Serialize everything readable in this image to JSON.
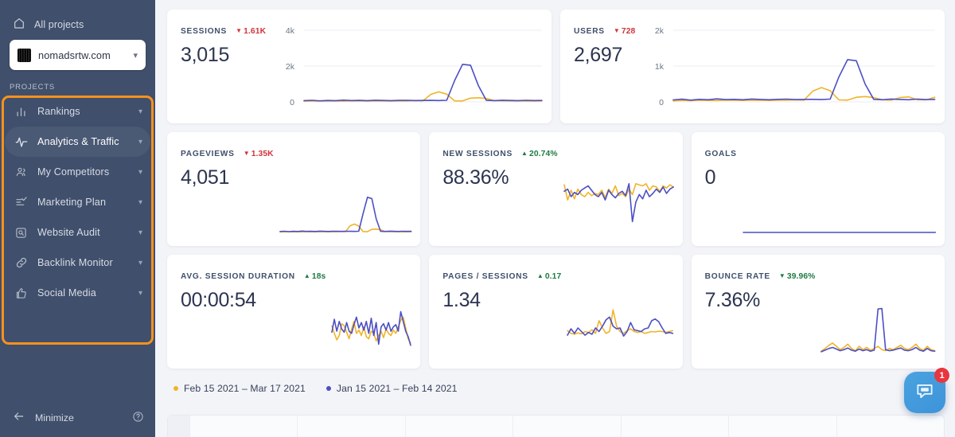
{
  "sidebar": {
    "all_projects_label": "All projects",
    "project_selector": {
      "name": "nomadsrtw.com",
      "chevron": "chevron-down-icon"
    },
    "section_label": "PROJECTS",
    "items": [
      {
        "label": "Rankings",
        "icon": "bar-chart-icon",
        "active": false
      },
      {
        "label": "Analytics & Traffic",
        "icon": "pulse-icon",
        "active": true
      },
      {
        "label": "My Competitors",
        "icon": "people-icon",
        "active": false
      },
      {
        "label": "Marketing Plan",
        "icon": "checklist-icon",
        "active": false
      },
      {
        "label": "Website Audit",
        "icon": "magnifier-box-icon",
        "active": false
      },
      {
        "label": "Backlink Monitor",
        "icon": "link-icon",
        "active": false
      },
      {
        "label": "Social Media",
        "icon": "thumbs-up-icon",
        "active": false
      }
    ],
    "minimize_label": "Minimize",
    "help_icon": "question-circle-icon",
    "highlight_color": "#f6921e",
    "bg_color": "#404f6b"
  },
  "colors": {
    "current_series": "#f0b429",
    "previous_series": "#4c4fc4",
    "positive": "#1f7a45",
    "negative": "#d0343c"
  },
  "legend": [
    {
      "label": "Feb 15 2021 – Mar 17 2021",
      "color": "#f0b429"
    },
    {
      "label": "Jan 15 2021 – Feb 14 2021",
      "color": "#4c4fc4"
    }
  ],
  "chat": {
    "icon": "chat-bubble-icon",
    "badge": "1"
  },
  "cards": [
    {
      "title": "SESSIONS",
      "value": "3,015",
      "delta": "1.61K",
      "delta_dir": "down",
      "delta_tone": "negative",
      "chart_data": {
        "type": "line",
        "axis": true,
        "yticks": [
          "4k",
          "2k",
          "0"
        ],
        "ylim": [
          0,
          4000
        ],
        "grid": true,
        "series": [
          {
            "name": "Feb 15 2021 – Mar 17 2021",
            "color": "#f0b429",
            "values": [
              40,
              50,
              45,
              55,
              50,
              45,
              60,
              55,
              50,
              60,
              55,
              50,
              60,
              55,
              65,
              60,
              420,
              560,
              430,
              60,
              55,
              210,
              230,
              190,
              70,
              60,
              55,
              60,
              50,
              45,
              55
            ]
          },
          {
            "name": "Jan 15 2021 – Feb 14 2021",
            "color": "#4c4fc4",
            "values": [
              70,
              90,
              60,
              80,
              70,
              100,
              75,
              85,
              70,
              95,
              80,
              70,
              85,
              90,
              75,
              80,
              85,
              75,
              90,
              1200,
              2100,
              2050,
              900,
              85,
              70,
              95,
              80,
              70,
              90,
              75,
              80
            ]
          }
        ]
      }
    },
    {
      "title": "USERS",
      "value": "2,697",
      "delta": "728",
      "delta_dir": "down",
      "delta_tone": "negative",
      "chart_data": {
        "type": "line",
        "axis": true,
        "yticks": [
          "2k",
          "1k",
          "0"
        ],
        "ylim": [
          0,
          2000
        ],
        "grid": true,
        "series": [
          {
            "name": "Feb 15 2021 – Mar 17 2021",
            "color": "#f0b429",
            "values": [
              30,
              40,
              35,
              45,
              40,
              38,
              50,
              45,
              40,
              50,
              45,
              40,
              50,
              48,
              55,
              50,
              300,
              400,
              310,
              55,
              48,
              130,
              150,
              120,
              60,
              50,
              120,
              140,
              60,
              55,
              130
            ]
          },
          {
            "name": "Jan 15 2021 – Feb 14 2021",
            "color": "#4c4fc4",
            "values": [
              55,
              75,
              50,
              70,
              60,
              85,
              65,
              72,
              60,
              80,
              68,
              60,
              72,
              78,
              64,
              68,
              72,
              64,
              78,
              700,
              1180,
              1150,
              500,
              72,
              60,
              80,
              68,
              60,
              78,
              64,
              68
            ]
          }
        ]
      }
    },
    {
      "title": "PAGEVIEWS",
      "value": "4,051",
      "delta": "1.35K",
      "delta_dir": "down",
      "delta_tone": "negative",
      "chart_data": {
        "type": "line",
        "axis": false,
        "ylim": [
          0,
          4000
        ],
        "grid": false,
        "series": [
          {
            "name": "Feb 15 2021 – Mar 17 2021",
            "color": "#f0b429",
            "values": [
              40,
              50,
              45,
              55,
              50,
              45,
              60,
              55,
              50,
              60,
              55,
              50,
              60,
              55,
              65,
              60,
              480,
              620,
              470,
              60,
              55,
              230,
              250,
              200,
              70,
              60,
              55,
              60,
              50,
              45,
              55
            ]
          },
          {
            "name": "Jan 15 2021 – Feb 14 2021",
            "color": "#4c4fc4",
            "values": [
              70,
              90,
              60,
              80,
              70,
              100,
              75,
              85,
              70,
              95,
              80,
              70,
              85,
              90,
              75,
              80,
              85,
              75,
              90,
              1400,
              2600,
              2500,
              1000,
              85,
              70,
              95,
              80,
              70,
              90,
              75,
              80
            ]
          }
        ]
      }
    },
    {
      "title": "NEW SESSIONS",
      "value": "88.36%",
      "delta": "20.74%",
      "delta_dir": "up",
      "delta_tone": "positive",
      "chart_data": {
        "type": "line",
        "axis": false,
        "ylim": [
          0,
          100
        ],
        "grid": false,
        "series": [
          {
            "name": "Feb 15 2021 – Mar 17 2021",
            "color": "#f0b429",
            "values": [
              88,
              60,
              78,
              62,
              80,
              70,
              66,
              74,
              68,
              72,
              70,
              78,
              64,
              80,
              72,
              86,
              68,
              72,
              66,
              80,
              70,
              90,
              88,
              86,
              90,
              78,
              86,
              84,
              76,
              86,
              82,
              88,
              84
            ]
          },
          {
            "name": "Jan 15 2021 – Feb 14 2021",
            "color": "#4c4fc4",
            "values": [
              76,
              80,
              66,
              74,
              70,
              78,
              82,
              86,
              78,
              70,
              66,
              74,
              60,
              78,
              70,
              64,
              72,
              76,
              68,
              90,
              20,
              56,
              70,
              62,
              78,
              66,
              72,
              80,
              74,
              84,
              72,
              80,
              84
            ]
          }
        ]
      }
    },
    {
      "title": "GOALS",
      "value": "0",
      "delta": "",
      "delta_dir": "none",
      "delta_tone": "none",
      "chart_data": {
        "type": "line",
        "axis": false,
        "ylim": [
          0,
          1
        ],
        "grid": false,
        "series": [
          {
            "name": "Jan 15 2021 – Feb 14 2021",
            "color": "#4c4fc4",
            "values": [
              0,
              0,
              0,
              0,
              0,
              0,
              0,
              0,
              0,
              0,
              0,
              0,
              0,
              0,
              0,
              0,
              0,
              0,
              0,
              0,
              0,
              0,
              0,
              0,
              0,
              0,
              0,
              0,
              0,
              0,
              0
            ]
          }
        ]
      }
    },
    {
      "title": "AVG. SESSION DURATION",
      "value": "00:00:54",
      "delta": "18s",
      "delta_dir": "up",
      "delta_tone": "positive",
      "chart_data": {
        "type": "line",
        "axis": false,
        "ylim": [
          0,
          100
        ],
        "grid": false,
        "series": [
          {
            "name": "Feb 15 2021 – Mar 17 2021",
            "color": "#f0b429",
            "values": [
              54,
              40,
              28,
              36,
              58,
              54,
              42,
              30,
              48,
              62,
              40,
              46,
              36,
              52,
              34,
              30,
              44,
              40,
              26,
              36,
              44,
              32,
              48,
              40,
              36,
              46,
              40,
              52,
              64,
              70,
              50,
              30,
              22
            ]
          },
          {
            "name": "Jan 15 2021 – Feb 14 2021",
            "color": "#4c4fc4",
            "values": [
              42,
              66,
              44,
              62,
              48,
              42,
              60,
              44,
              40,
              56,
              70,
              50,
              60,
              46,
              62,
              40,
              68,
              36,
              60,
              20,
              52,
              58,
              46,
              60,
              44,
              52,
              56,
              44,
              80,
              62,
              44,
              34,
              18
            ]
          }
        ]
      }
    },
    {
      "title": "PAGES / SESSIONS",
      "value": "1.34",
      "delta": "0.17",
      "delta_dir": "up",
      "delta_tone": "positive",
      "chart_data": {
        "type": "line",
        "axis": false,
        "ylim": [
          0,
          3
        ],
        "grid": false,
        "series": [
          {
            "name": "Feb 15 2021 – Mar 17 2021",
            "color": "#f0b429",
            "values": [
              1.35,
              1.2,
              1.15,
              1.22,
              1.18,
              1.3,
              1.25,
              1.4,
              1.2,
              1.9,
              1.5,
              1.2,
              1.3,
              2.5,
              1.6,
              1.3,
              1.2,
              1.35,
              1.45,
              1.3,
              1.25,
              1.3,
              1.2,
              1.25,
              1.3,
              1.28,
              1.32,
              1.3,
              1.25,
              1.3,
              1.35
            ]
          },
          {
            "name": "Jan 15 2021 – Feb 14 2021",
            "color": "#4c4fc4",
            "values": [
              1.1,
              1.45,
              1.2,
              1.5,
              1.3,
              1.1,
              1.25,
              1.15,
              1.5,
              1.3,
              1.6,
              1.95,
              2.1,
              1.6,
              1.45,
              1.5,
              1.05,
              1.3,
              1.8,
              1.4,
              1.35,
              1.3,
              1.45,
              1.5,
              1.9,
              2.0,
              1.85,
              1.5,
              1.2,
              1.25,
              1.2
            ]
          }
        ]
      }
    },
    {
      "title": "BOUNCE RATE",
      "value": "7.36%",
      "delta": "39.96%",
      "delta_dir": "down",
      "delta_tone": "positive",
      "chart_data": {
        "type": "line",
        "axis": false,
        "ylim": [
          0,
          100
        ],
        "grid": false,
        "series": [
          {
            "name": "Feb 15 2021 – Mar 17 2021",
            "color": "#f0b429",
            "values": [
              7,
              12,
              18,
              22,
              16,
              10,
              14,
              20,
              12,
              8,
              16,
              10,
              14,
              9,
              12,
              16,
              10,
              8,
              12,
              10,
              14,
              18,
              12,
              10,
              14,
              20,
              12,
              9,
              16,
              10,
              8
            ]
          },
          {
            "name": "Jan 15 2021 – Feb 14 2021",
            "color": "#4c4fc4",
            "values": [
              6,
              9,
              12,
              14,
              11,
              8,
              10,
              13,
              9,
              7,
              11,
              8,
              10,
              7,
              9,
              85,
              86,
              10,
              8,
              9,
              11,
              13,
              9,
              8,
              10,
              14,
              9,
              7,
              12,
              8,
              7
            ]
          }
        ]
      }
    }
  ]
}
